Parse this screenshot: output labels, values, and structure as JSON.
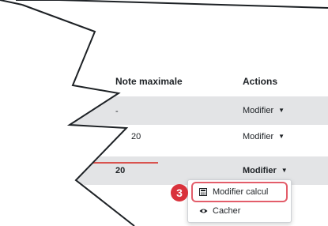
{
  "table": {
    "headers": {
      "grade": "Note maximale",
      "actions": "Actions"
    },
    "rows": [
      {
        "grade": "-",
        "action": "Modifier"
      },
      {
        "grade": "20",
        "action": "Modifier"
      },
      {
        "grade": "20",
        "action": "Modifier"
      }
    ]
  },
  "menu": {
    "items": [
      {
        "label": "Modifier calcul",
        "icon": "calculator-icon"
      },
      {
        "label": "Cacher",
        "icon": "eye-icon"
      }
    ]
  },
  "step_badge": "3",
  "colors": {
    "accent_red": "#d9323c",
    "row_gray": "#e3e4e6"
  }
}
